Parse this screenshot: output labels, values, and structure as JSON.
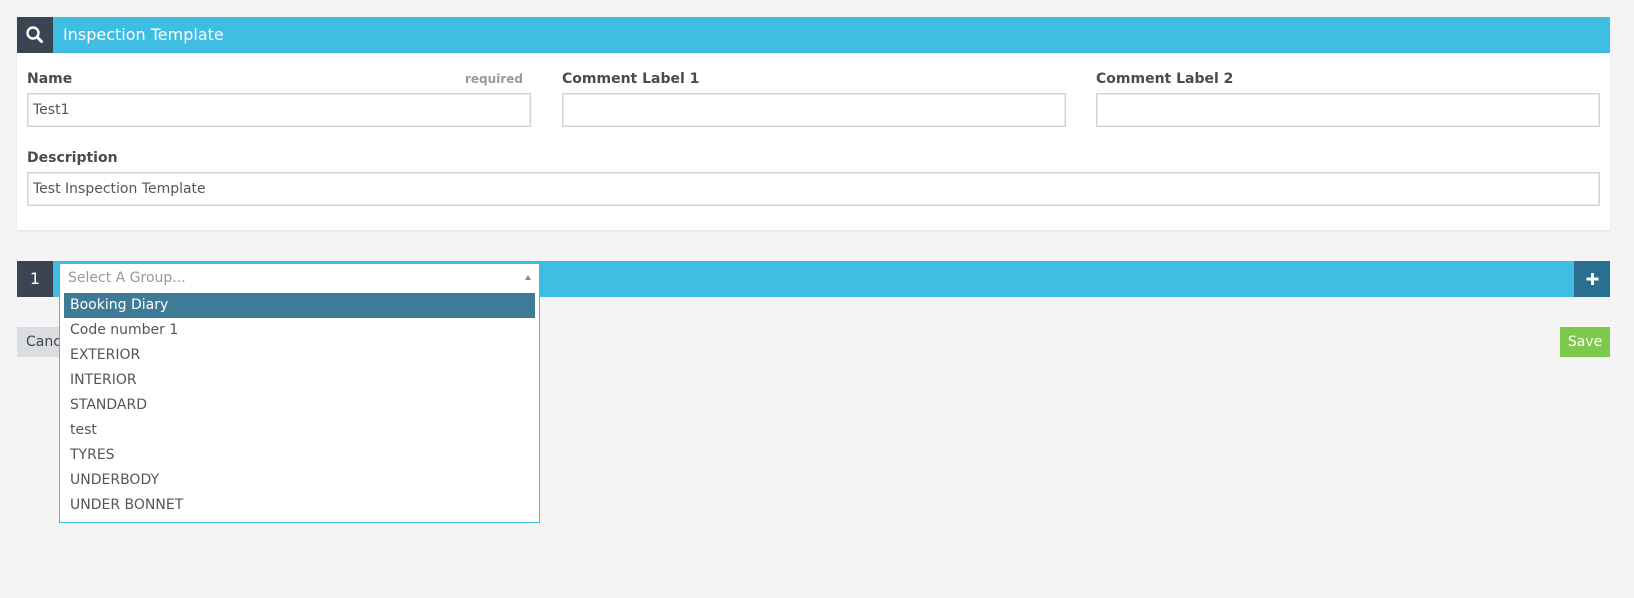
{
  "panel": {
    "title": "Inspection Template",
    "search_icon": "search-icon",
    "fields": {
      "name": {
        "label": "Name",
        "required_note": "required",
        "value": "Test1"
      },
      "comment_label_1": {
        "label": "Comment Label 1",
        "value": ""
      },
      "comment_label_2": {
        "label": "Comment Label 2",
        "value": ""
      },
      "description": {
        "label": "Description",
        "value": "Test Inspection Template"
      }
    }
  },
  "group_row": {
    "number": "1",
    "select_placeholder": "Select A Group...",
    "add_icon": "plus-icon"
  },
  "dropdown": {
    "options": [
      {
        "label": "Booking Diary",
        "selected": true
      },
      {
        "label": "Code number 1",
        "selected": false
      },
      {
        "label": "EXTERIOR",
        "selected": false
      },
      {
        "label": "INTERIOR",
        "selected": false
      },
      {
        "label": "STANDARD",
        "selected": false
      },
      {
        "label": "test",
        "selected": false
      },
      {
        "label": "TYRES",
        "selected": false
      },
      {
        "label": "UNDERBODY",
        "selected": false
      },
      {
        "label": "UNDER BONNET",
        "selected": false
      }
    ]
  },
  "actions": {
    "cancel_label": "Cancel",
    "save_label": "Save"
  },
  "colors": {
    "header_blue": "#40bde3",
    "dark_navy": "#3a4453",
    "add_button": "#2a6f8f",
    "selected_option": "#3f7a96",
    "save_green": "#7cc94b"
  }
}
